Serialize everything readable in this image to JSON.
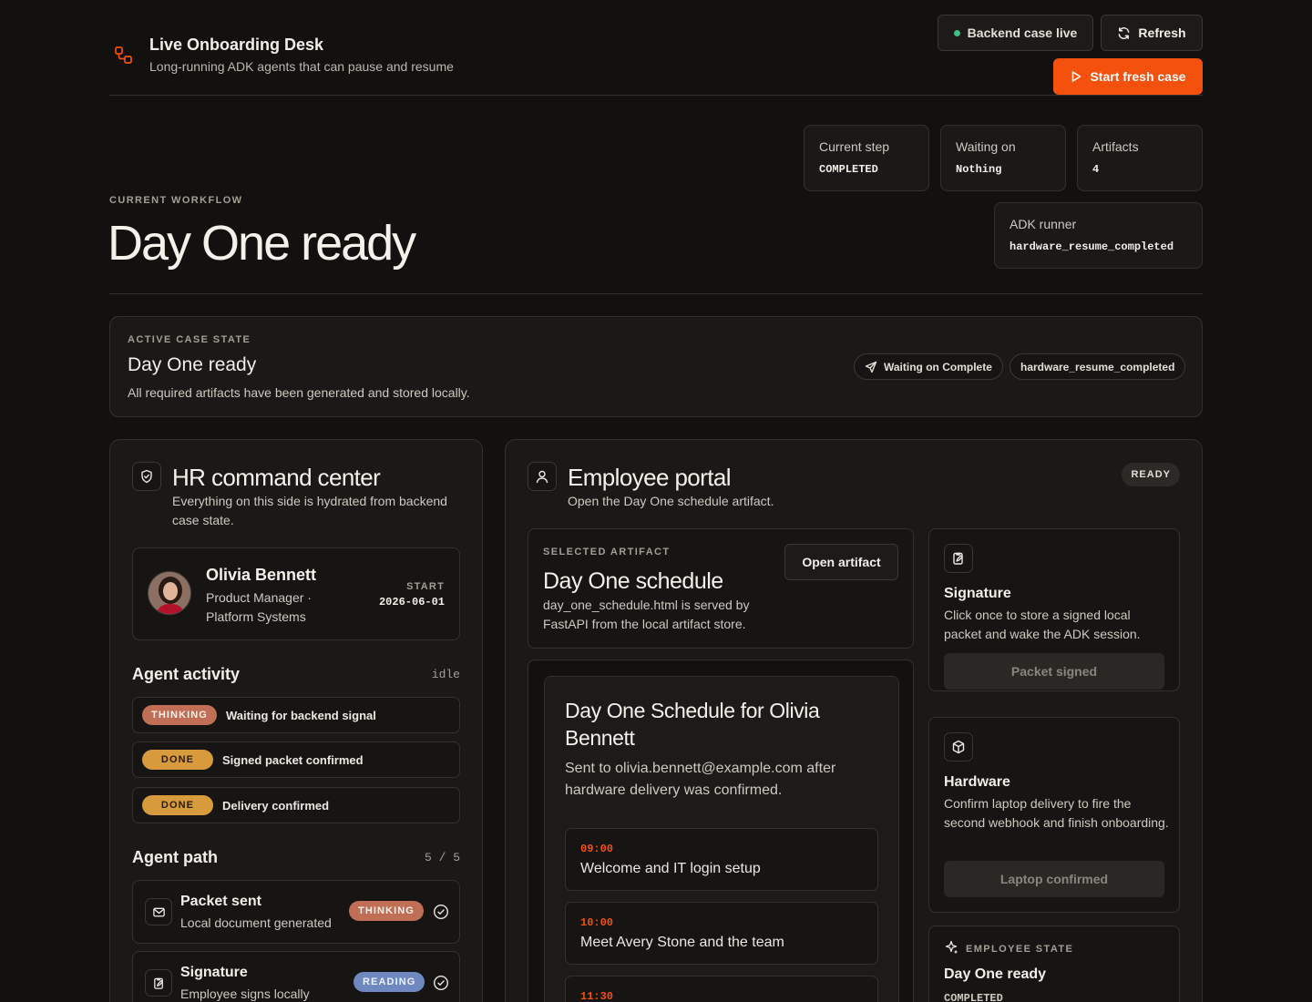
{
  "header": {
    "app_title": "Live Onboarding Desk",
    "app_subtitle": "Long-running ADK agents that can pause and resume",
    "status_label": "Backend case live",
    "refresh_label": "Refresh",
    "start_label": "Start fresh case",
    "accent": "#f4500e",
    "status_color": "#3fbf86"
  },
  "hero": {
    "eyebrow": "CURRENT WORKFLOW",
    "title": "Day One ready",
    "stats": [
      {
        "label": "Current step",
        "value": "COMPLETED"
      },
      {
        "label": "Waiting on",
        "value": "Nothing"
      },
      {
        "label": "Artifacts",
        "value": "4"
      },
      {
        "label": "ADK runner",
        "value": "hardware_resume_completed"
      }
    ]
  },
  "active_case": {
    "eyebrow": "ACTIVE CASE STATE",
    "title": "Day One ready",
    "description": "All required artifacts have been generated and stored locally.",
    "pills": [
      "Waiting on Complete",
      "hardware_resume_completed"
    ]
  },
  "hr_panel": {
    "title": "HR command center",
    "subtitle": "Everything on this side is hydrated from backend case state.",
    "employee": {
      "name": "Olivia Bennett",
      "role": "Product Manager · Platform Systems",
      "start_label": "START",
      "start_date": "2026-06-01"
    },
    "activity": {
      "title": "Agent activity",
      "status": "idle",
      "items": [
        {
          "badge": "THINKING",
          "kind": "thinking",
          "text": "Waiting for backend signal"
        },
        {
          "badge": "DONE",
          "kind": "done",
          "text": "Signed packet confirmed"
        },
        {
          "badge": "DONE",
          "kind": "done",
          "text": "Delivery confirmed"
        }
      ]
    },
    "path": {
      "title": "Agent path",
      "progress": "5 / 5",
      "steps": [
        {
          "name": "Packet sent",
          "desc": "Local document generated",
          "badge": "THINKING",
          "kind": "thinking",
          "icon": "mail-icon"
        },
        {
          "name": "Signature",
          "desc": "Employee signs locally",
          "badge": "READING",
          "kind": "reading",
          "icon": "clipboard-edit-icon"
        }
      ]
    }
  },
  "portal": {
    "title": "Employee portal",
    "subtitle": "Open the Day One schedule artifact.",
    "badge": "READY",
    "artifact": {
      "eyebrow": "SELECTED ARTIFACT",
      "title": "Day One schedule",
      "description": "day_one_schedule.html is served by FastAPI from the local artifact store.",
      "open_label": "Open artifact"
    },
    "preview": {
      "title": "Day One Schedule for Olivia Bennett",
      "subtitle": "Sent to olivia.bennett@example.com after hardware delivery was confirmed.",
      "slots": [
        {
          "time": "09:00",
          "name": "Welcome and IT login setup"
        },
        {
          "time": "10:00",
          "name": "Meet Avery Stone and the team"
        },
        {
          "time": "11:30",
          "name": ""
        }
      ]
    },
    "signature": {
      "title": "Signature",
      "description": "Click once to store a signed local packet and wake the ADK session.",
      "button": "Packet signed"
    },
    "hardware": {
      "title": "Hardware",
      "description": "Confirm laptop delivery to fire the second webhook and finish onboarding.",
      "button": "Laptop confirmed"
    },
    "employee_state": {
      "eyebrow": "EMPLOYEE STATE",
      "title": "Day One ready",
      "value": "COMPLETED"
    }
  }
}
